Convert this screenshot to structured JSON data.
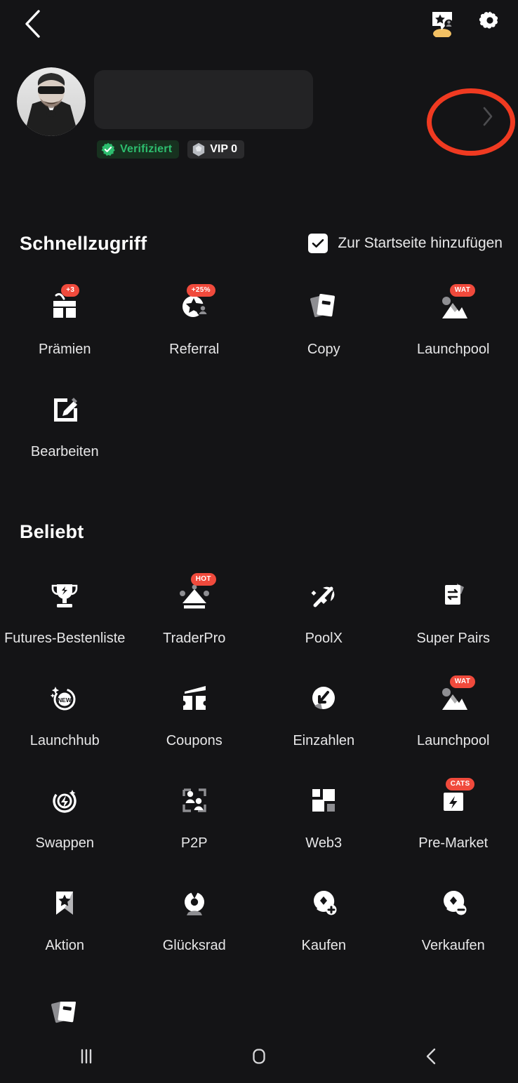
{
  "theme": {
    "background": "#141416",
    "text_primary": "#ffffff",
    "text_secondary": "#e7e7e8",
    "badge_red": "#f04a3c",
    "verified_green": "#2dbd6e",
    "annotation_red": "#f03a21"
  },
  "topbar": {
    "back_icon": "chevron-left-icon",
    "referral_icon": "referral-card-icon",
    "settings_icon": "gear-icon"
  },
  "profile": {
    "avatar_icon": "user-avatar-photo",
    "username_value": "",
    "username_redacted": true,
    "verified_label": "Verifiziert",
    "verified_icon": "verified-check-icon",
    "vip_label": "VIP 0",
    "vip_icon": "vip-gem-icon",
    "detail_arrow_icon": "chevron-right-icon",
    "annotation": "red-ellipse-highlight"
  },
  "quick_access": {
    "title": "Schnellzugriff",
    "homescreen_toggle": {
      "label": "Zur Startseite hinzufügen",
      "checked": true
    },
    "items": [
      {
        "label": "Prämien",
        "icon": "gift-icon",
        "badge": "+3"
      },
      {
        "label": "Referral",
        "icon": "referral-star-icon",
        "badge": "+25%"
      },
      {
        "label": "Copy",
        "icon": "copy-cards-icon",
        "badge": ""
      },
      {
        "label": "Launchpool",
        "icon": "launchpool-icon",
        "badge": "WAT"
      },
      {
        "label": "Bearbeiten",
        "icon": "edit-pencil-icon",
        "badge": ""
      }
    ]
  },
  "popular": {
    "title": "Beliebt",
    "items": [
      {
        "label": "Futures-Bestenliste",
        "icon": "trophy-icon",
        "badge": ""
      },
      {
        "label": "TraderPro",
        "icon": "crown-icon",
        "badge": "HOT"
      },
      {
        "label": "PoolX",
        "icon": "pickaxe-icon",
        "badge": ""
      },
      {
        "label": "Super Pairs",
        "icon": "swap-card-icon",
        "badge": ""
      },
      {
        "label": "Launchhub",
        "icon": "launchhub-new-icon",
        "badge": ""
      },
      {
        "label": "Coupons",
        "icon": "ticket-icon",
        "badge": ""
      },
      {
        "label": "Einzahlen",
        "icon": "deposit-arrow-icon",
        "badge": ""
      },
      {
        "label": "Launchpool",
        "icon": "launchpool-icon",
        "badge": "WAT"
      },
      {
        "label": "Swappen",
        "icon": "swap-bolt-icon",
        "badge": ""
      },
      {
        "label": "P2P",
        "icon": "p2p-people-icon",
        "badge": ""
      },
      {
        "label": "Web3",
        "icon": "web3-squares-icon",
        "badge": ""
      },
      {
        "label": "Pre-Market",
        "icon": "pre-market-icon",
        "badge": "CATS"
      },
      {
        "label": "Aktion",
        "icon": "bookmark-star-icon",
        "badge": ""
      },
      {
        "label": "Glücksrad",
        "icon": "wheel-icon",
        "badge": ""
      },
      {
        "label": "Kaufen",
        "icon": "buy-coin-icon",
        "badge": ""
      },
      {
        "label": "Verkaufen",
        "icon": "sell-coin-icon",
        "badge": ""
      }
    ],
    "partial_next_row": [
      {
        "label": "",
        "icon": "copy-cards-icon"
      }
    ]
  },
  "system_nav": {
    "recents_icon": "recents-bars-icon",
    "home_icon": "home-square-icon",
    "back_icon": "chevron-left-icon"
  }
}
